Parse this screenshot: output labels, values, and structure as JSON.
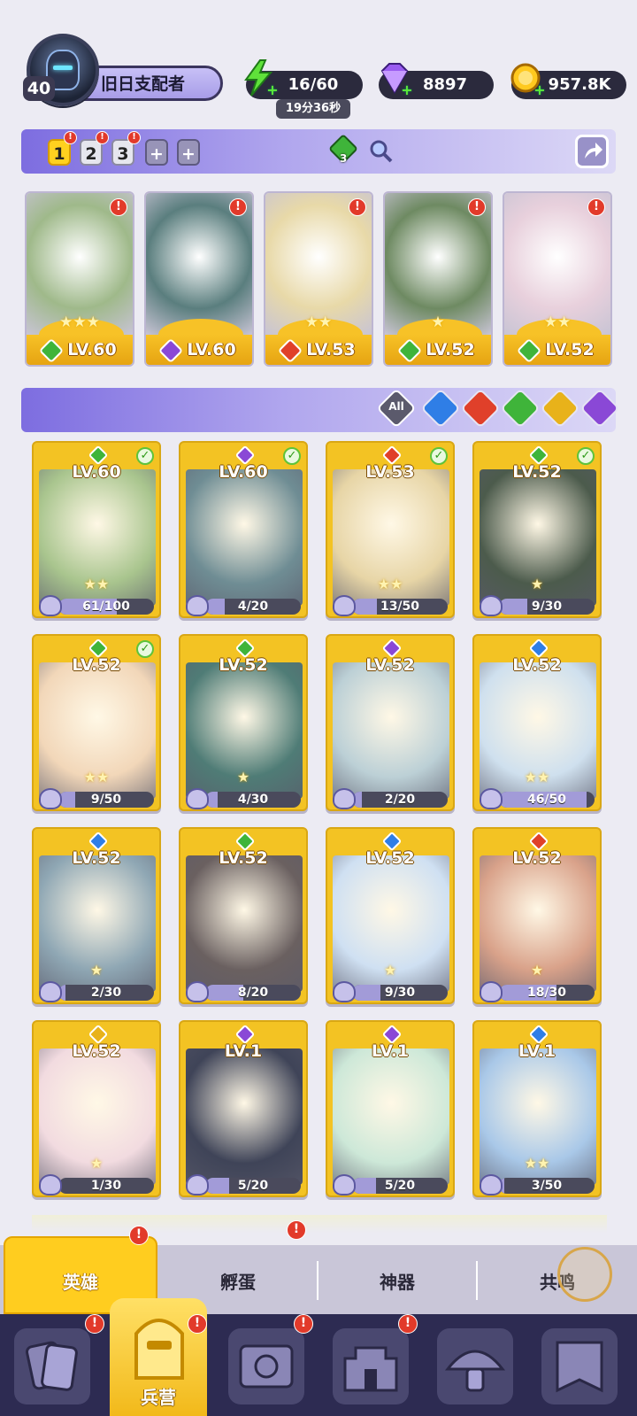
{
  "player": {
    "level": "40",
    "name": "旧日支配者"
  },
  "resources": {
    "energy": "16/60",
    "energy_timer": "19分36秒",
    "gems": "8897",
    "gold": "957.8K"
  },
  "team_slots": [
    "1",
    "2",
    "3",
    "+",
    "+"
  ],
  "team_power_badge": "3",
  "team": [
    {
      "level": "LV.60",
      "element": "nature",
      "stars": "★★★"
    },
    {
      "level": "LV.60",
      "element": "dark",
      "stars": ""
    },
    {
      "level": "LV.53",
      "element": "fire",
      "stars": "★★"
    },
    {
      "level": "LV.52",
      "element": "nature",
      "stars": "★"
    },
    {
      "level": "LV.52",
      "element": "nature",
      "stars": "★★"
    }
  ],
  "filters": {
    "all_label": "All",
    "elements": [
      "water",
      "fire",
      "nature",
      "light",
      "dark"
    ]
  },
  "heroes": [
    {
      "level": "LV.60",
      "element": "nature",
      "stars": "★★",
      "progress": "61/100",
      "ratio": 0.61,
      "checked": true
    },
    {
      "level": "LV.60",
      "element": "dark",
      "stars": "",
      "progress": "4/20",
      "ratio": 0.2,
      "checked": true
    },
    {
      "level": "LV.53",
      "element": "fire",
      "stars": "★★",
      "progress": "13/50",
      "ratio": 0.26,
      "checked": true
    },
    {
      "level": "LV.52",
      "element": "nature",
      "stars": "★",
      "progress": "9/30",
      "ratio": 0.3,
      "checked": true
    },
    {
      "level": "LV.52",
      "element": "nature",
      "stars": "★★",
      "progress": "9/50",
      "ratio": 0.18,
      "checked": true
    },
    {
      "level": "LV.52",
      "element": "nature",
      "stars": "★",
      "progress": "4/30",
      "ratio": 0.13,
      "checked": false
    },
    {
      "level": "LV.52",
      "element": "dark",
      "stars": "",
      "progress": "2/20",
      "ratio": 0.1,
      "checked": false
    },
    {
      "level": "LV.52",
      "element": "water",
      "stars": "★★",
      "progress": "46/50",
      "ratio": 0.92,
      "checked": false
    },
    {
      "level": "LV.52",
      "element": "water",
      "stars": "★",
      "progress": "2/30",
      "ratio": 0.07,
      "checked": false
    },
    {
      "level": "LV.52",
      "element": "nature",
      "stars": "",
      "progress": "8/20",
      "ratio": 0.4,
      "checked": false
    },
    {
      "level": "LV.52",
      "element": "water",
      "stars": "★",
      "progress": "9/30",
      "ratio": 0.3,
      "checked": false
    },
    {
      "level": "LV.52",
      "element": "fire",
      "stars": "★",
      "progress": "18/30",
      "ratio": 0.6,
      "checked": false
    },
    {
      "level": "LV.52",
      "element": "light",
      "stars": "★",
      "progress": "1/30",
      "ratio": 0.03,
      "checked": false
    },
    {
      "level": "LV.1",
      "element": "dark",
      "stars": "",
      "progress": "5/20",
      "ratio": 0.25,
      "checked": false
    },
    {
      "level": "LV.1",
      "element": "dark",
      "stars": "",
      "progress": "5/20",
      "ratio": 0.25,
      "checked": false
    },
    {
      "level": "LV.1",
      "element": "water",
      "stars": "★★",
      "progress": "3/50",
      "ratio": 0.06,
      "checked": false
    }
  ],
  "tabs": [
    "英雄",
    "孵蛋",
    "神器",
    "共鸣"
  ],
  "nav": {
    "barracks_label": "兵营"
  },
  "colors": {
    "nature": "#3fb43a",
    "dark": "#8a48d6",
    "fire": "#e0402a",
    "water": "#2f7ee6",
    "light": "#e8b21a",
    "accent": "#ffcd1f"
  }
}
